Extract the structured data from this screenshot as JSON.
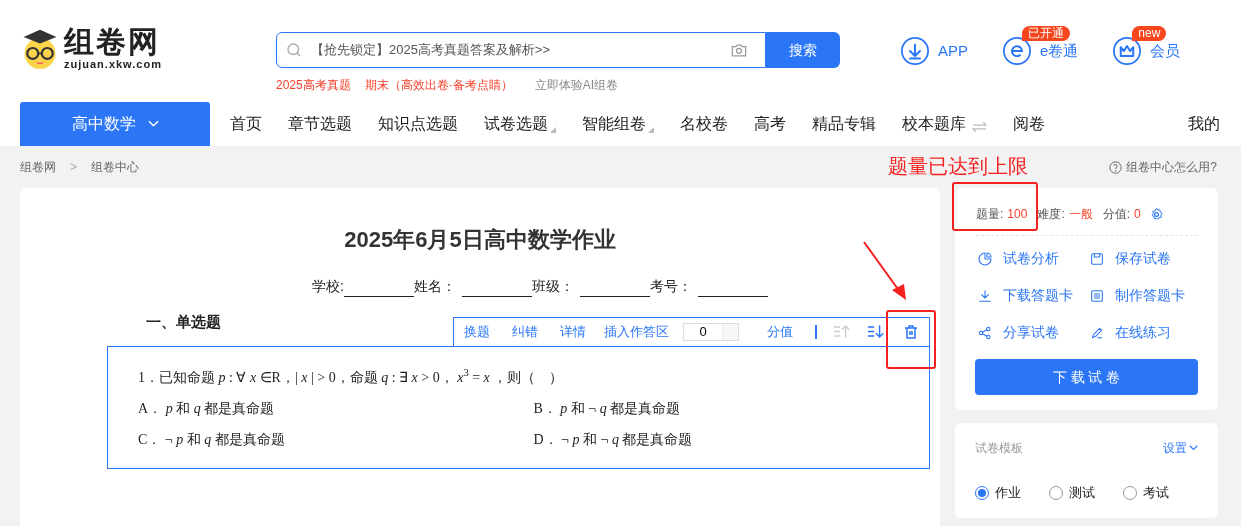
{
  "header": {
    "logo_text": "组卷网",
    "logo_domain": "zujuan.xkw.com",
    "search": {
      "placeholder": "【抢先锁定】2025高考真题答案及解析>>",
      "button": "搜索"
    },
    "hot_links": [
      {
        "label": "2025高考真题",
        "kind": "hot"
      },
      {
        "label": "期末（高效出卷·备考点睛）",
        "kind": "hot"
      },
      {
        "label": "立即体验AI组卷",
        "kind": "plain"
      }
    ],
    "actions": [
      {
        "label": "APP",
        "kind": "download"
      },
      {
        "label": "e卷通",
        "kind": "e",
        "badge": "已开通"
      },
      {
        "label": "会员",
        "kind": "crown",
        "badge": "new"
      }
    ]
  },
  "nav": {
    "subject": "高中数学",
    "items": [
      {
        "label": "首页",
        "kind": "plain"
      },
      {
        "label": "章节选题",
        "kind": "plain"
      },
      {
        "label": "知识点选题",
        "kind": "plain"
      },
      {
        "label": "试卷选题",
        "kind": "dropdown"
      },
      {
        "label": "智能组卷",
        "kind": "dropdown"
      },
      {
        "label": "名校卷",
        "kind": "plain"
      },
      {
        "label": "高考",
        "kind": "plain"
      },
      {
        "label": "精品专辑",
        "kind": "plain"
      },
      {
        "label": "校本题库",
        "kind": "swap"
      },
      {
        "label": "阅卷",
        "kind": "plain"
      }
    ],
    "mine": "我的"
  },
  "breadcrumb": {
    "items": [
      "组卷网",
      "组卷中心"
    ],
    "separator": ">"
  },
  "help": "组卷中心怎么用?",
  "paper": {
    "title": "2025年6月5日高中数学作业",
    "fields": [
      "学校:",
      "姓名：",
      "班级：",
      "考号："
    ],
    "section": "一、单选题",
    "toolbar": {
      "buttons": [
        "换题",
        "纠错",
        "详情",
        "插入作答区"
      ],
      "score_value": "0",
      "score_label": "分值",
      "move_up_disabled": true,
      "move_down_disabled": false
    },
    "question": {
      "stem": "1．已知命题 *p* : ∀ *x* ∈R，| *x* | > 0，命题 *q* : ∃ *x* > 0， *x*$^{3}$ = *x* ，则（　）",
      "options": [
        "A． *p* 和 *q* 都是真命题",
        "B． *p* 和 ¬ *q* 都是真命题",
        "C． ¬ *p* 和 *q* 都是真命题",
        "D． ¬ *p* 和 ¬ *q* 都是真命题"
      ]
    }
  },
  "summary": {
    "stats": [
      {
        "label": "题量:",
        "value": "100"
      },
      {
        "label": "难度:",
        "value": "一般"
      },
      {
        "label": "分值:",
        "value": "0"
      }
    ],
    "actions": [
      {
        "label": "试卷分析",
        "kind": "pie"
      },
      {
        "label": "保存试卷",
        "kind": "save"
      },
      {
        "label": "下载答题卡",
        "kind": "download"
      },
      {
        "label": "制作答题卡",
        "kind": "card"
      },
      {
        "label": "分享试卷",
        "kind": "share"
      },
      {
        "label": "在线练习",
        "kind": "pen"
      }
    ],
    "download": "下 载 试 卷"
  },
  "template": {
    "title": "试卷模板",
    "action": "设置",
    "options": [
      {
        "label": "作业",
        "selected": true
      },
      {
        "label": "测试",
        "selected": false
      },
      {
        "label": "考试",
        "selected": false
      }
    ]
  },
  "annotation": {
    "text": "题量已达到上限"
  }
}
